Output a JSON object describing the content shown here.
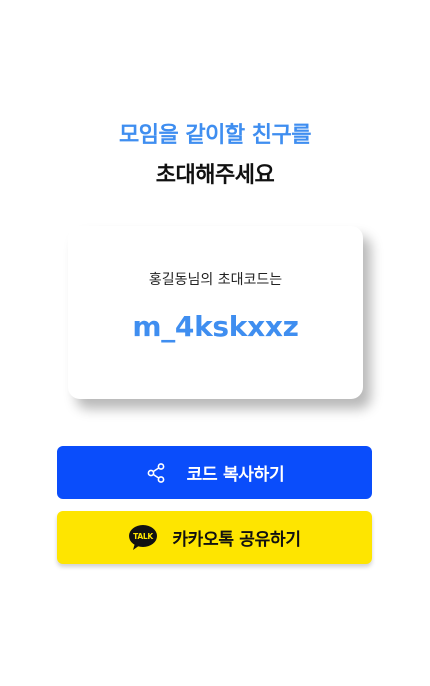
{
  "invite": {
    "heading_accent": "모임을 같이할 친구를",
    "heading_main": "초대해주세요",
    "caption": "홍길동님의 초대코드는",
    "code": "m_4kskxxz"
  },
  "actions": {
    "copy": {
      "label": "코드 복사하기",
      "icon": "share-icon",
      "color": "#0a4dfb"
    },
    "kakao": {
      "label": "카카오톡 공유하기",
      "icon": "kakaotalk-icon",
      "icon_text": "TALK",
      "color": "#fee500"
    }
  },
  "colors": {
    "accent": "#3f8ef0",
    "text": "#111111"
  }
}
